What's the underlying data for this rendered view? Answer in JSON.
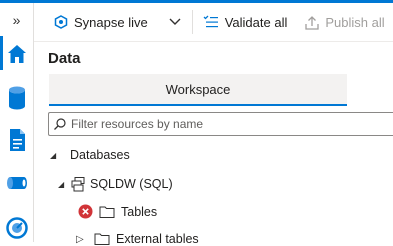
{
  "toolbar": {
    "workspace_mode": "Synapse live",
    "validate_all": "Validate all",
    "publish_all": "Publish all"
  },
  "panel": {
    "title": "Data",
    "tab": "Workspace",
    "search_placeholder": "Filter resources by name"
  },
  "tree": {
    "databases": "Databases",
    "db_name": "SQLDW (SQL)",
    "tables": "Tables",
    "external_tables": "External tables"
  },
  "rail": {
    "collapse": "»"
  },
  "colors": {
    "accent": "#0078d4",
    "error": "#d13438"
  }
}
